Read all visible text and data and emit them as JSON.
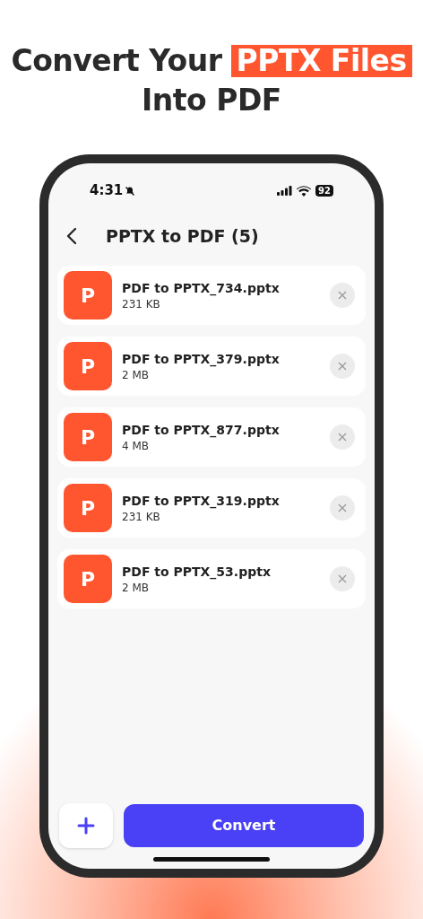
{
  "headline": {
    "before": "Convert Your",
    "highlight": "PPTX Files",
    "line2": "Into PDF"
  },
  "status_bar": {
    "time": "4:31",
    "battery": "92"
  },
  "header": {
    "title": "PPTX to PDF (5)"
  },
  "files": [
    {
      "icon_letter": "P",
      "name": "PDF to PPTX_734.pptx",
      "size": "231 KB"
    },
    {
      "icon_letter": "P",
      "name": "PDF to PPTX_379.pptx",
      "size": "2 MB"
    },
    {
      "icon_letter": "P",
      "name": "PDF to PPTX_877.pptx",
      "size": "4 MB"
    },
    {
      "icon_letter": "P",
      "name": "PDF to PPTX_319.pptx",
      "size": "231 KB"
    },
    {
      "icon_letter": "P",
      "name": "PDF to PPTX_53.pptx",
      "size": "2 MB"
    }
  ],
  "actions": {
    "convert_label": "Convert"
  }
}
